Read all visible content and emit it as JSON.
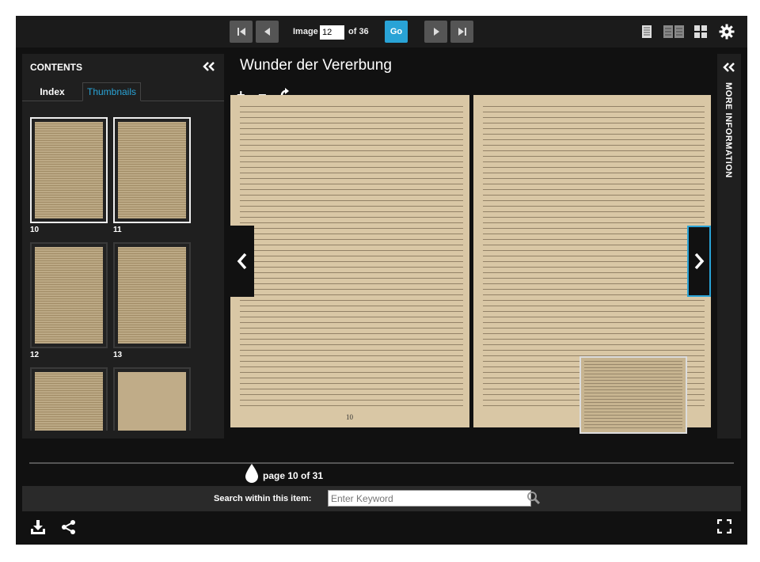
{
  "toolbar": {
    "image_label": "Image",
    "current_image": "12",
    "of_label": "of 36",
    "go_label": "Go",
    "first_icon": "skip-first-icon",
    "prev_icon": "prev-icon",
    "next_icon": "next-icon",
    "last_icon": "skip-last-icon",
    "view_modes": [
      "single-page-icon",
      "two-page-icon",
      "grid-icon"
    ],
    "settings_icon": "gear-icon"
  },
  "sidebar": {
    "title": "CONTENTS",
    "tabs": [
      "Index",
      "Thumbnails"
    ],
    "active_tab": "Thumbnails",
    "thumbnails": [
      {
        "label": "10",
        "selected": true
      },
      {
        "label": "11",
        "selected": true
      },
      {
        "label": "12",
        "selected": false
      },
      {
        "label": "13",
        "selected": false
      },
      {
        "label": "",
        "selected": false
      },
      {
        "label": "",
        "selected": false
      }
    ]
  },
  "main": {
    "title": "Wunder der Vererbung",
    "zoom_in": "+",
    "zoom_out": "−",
    "left_page_number": "10"
  },
  "right_panel": {
    "title": "MORE INFORMATION"
  },
  "footer": {
    "page_indicator": "page 10 of 31",
    "search_label": "Search within this item:",
    "search_placeholder": "Enter Keyword"
  },
  "colors": {
    "accent": "#29a3d6",
    "background": "#111111",
    "panel": "#1f1f1f"
  }
}
